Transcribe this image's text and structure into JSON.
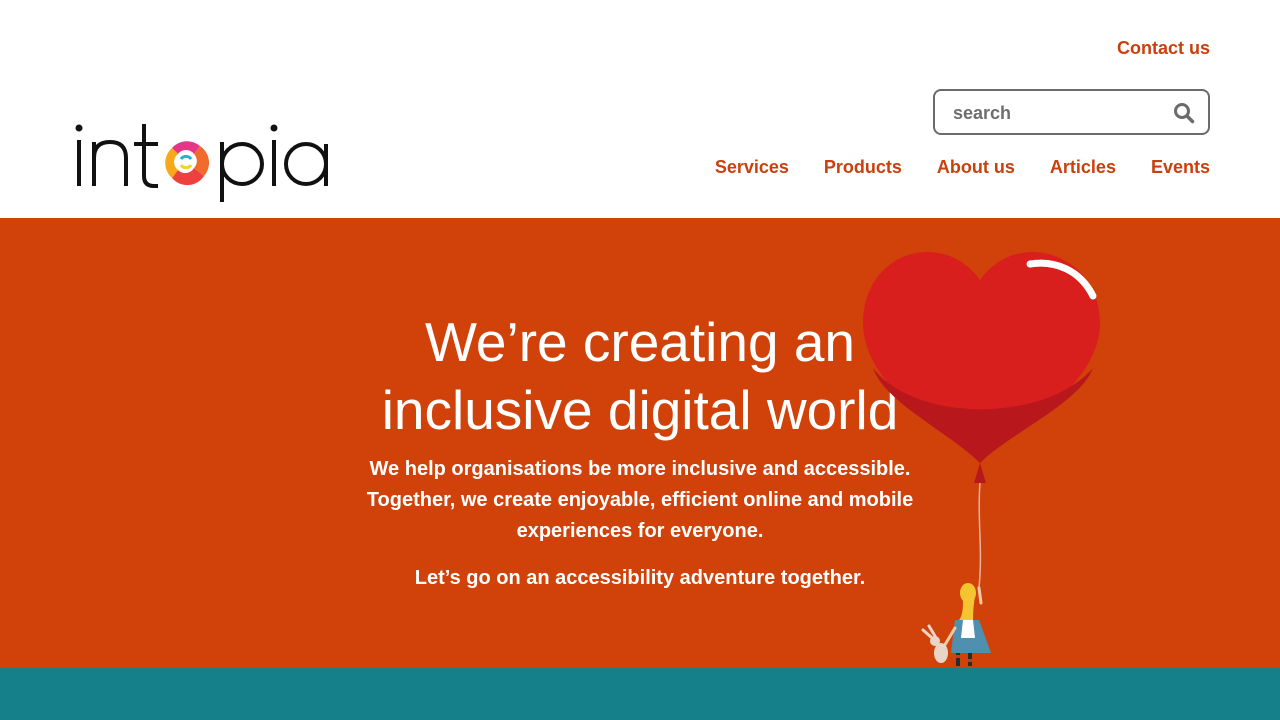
{
  "brand": {
    "logo_text": "intopia",
    "accent_color": "#c9400e",
    "hero_color": "#d1420b",
    "band_color": "#16808a"
  },
  "header": {
    "contact_label": "Contact us",
    "search": {
      "placeholder": "search",
      "value": "",
      "icon": "search-icon"
    },
    "nav": [
      {
        "label": "Services"
      },
      {
        "label": "Products"
      },
      {
        "label": "About us"
      },
      {
        "label": "Articles"
      },
      {
        "label": "Events"
      }
    ]
  },
  "hero": {
    "title_line1": "We’re creating an",
    "title_line2": "inclusive digital world",
    "description_line1": "We help organisations be more inclusive and accessible.",
    "description_line2": "Together, we create enjoyable, efficient online and mobile",
    "description_line3": "experiences for everyone.",
    "cta": "Let’s go on an accessibility adventure together.",
    "illustration": "heart-balloon-girl-illustration"
  }
}
